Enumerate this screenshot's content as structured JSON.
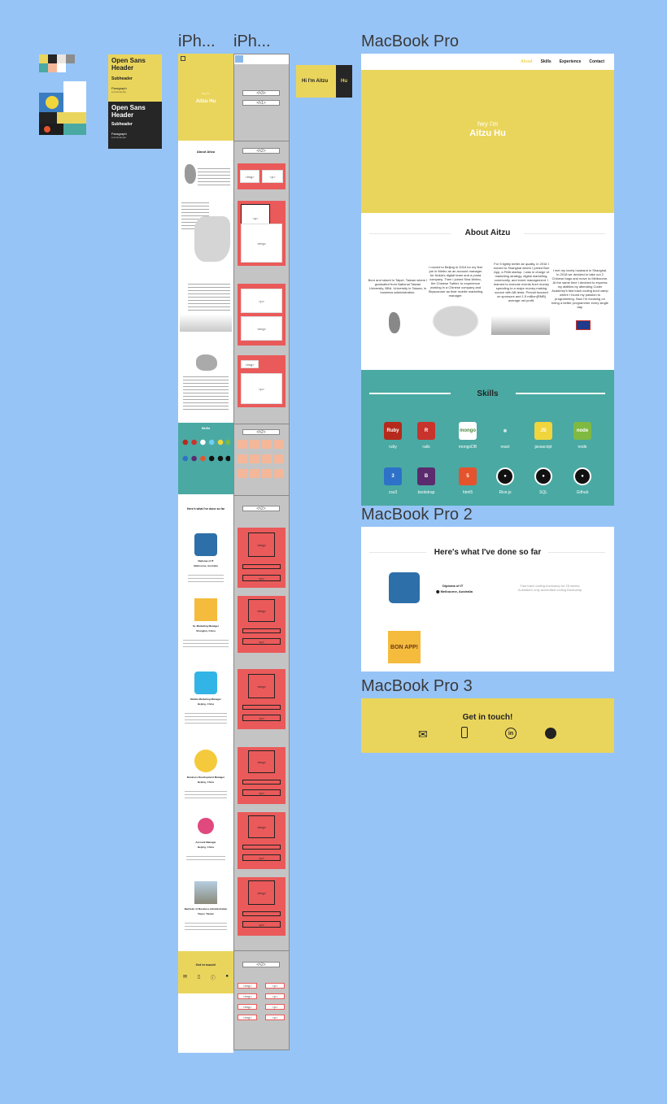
{
  "frames": {
    "iphone1": "iPh...",
    "iphone2": "iPh...",
    "macbook": "MacBook Pro",
    "macbook2": "MacBook Pro 2",
    "macbook3": "MacBook Pro 3"
  },
  "style_guide": {
    "light": {
      "header": "Open Sans Header",
      "subheader": "Subheader",
      "paragraph": "Paragraph",
      "link": "Link Example"
    },
    "dark": {
      "header": "Open Sans Header",
      "subheader": "Subheader",
      "paragraph": "Paragraph",
      "link": "Link Example"
    },
    "colors": [
      "#ead55c",
      "#262626",
      "#eae6df",
      "#8c8c8c",
      "#4aa9a3",
      "#f4b799",
      "#ffffff"
    ]
  },
  "logo": {
    "text": "Hi I'm Aitzu",
    "accent": "Hu"
  },
  "iphone": {
    "hero_hey": "hey i'm",
    "hero_name": "Aitzu Hu",
    "about_title": "About Aitzu",
    "skills_title": "Skills",
    "done_title": "Here's what I've done so far",
    "contact_title": "Get in touch!",
    "jobs": [
      {
        "title": "Diploma of IT",
        "place": "Melbourne, Australia"
      },
      {
        "title": "Sr. Marketing Manager",
        "place": "Shanghai, China"
      },
      {
        "title": "Mobile Marketing Manager",
        "place": "Beijing, China"
      },
      {
        "title": "Business Development Manager",
        "place": "Beijing, China"
      },
      {
        "title": "Account Manager",
        "place": "Beijing, China"
      },
      {
        "title": "Bachelor of Business Administration",
        "place": "Taipei, Taiwan"
      }
    ]
  },
  "wireframe": {
    "h3": "<h3>",
    "h1": "<h1>",
    "h2": "<h2>",
    "img": "<img>",
    "p": "<p>"
  },
  "macbook": {
    "nav": [
      "About",
      "Skills",
      "Experience",
      "Contact"
    ],
    "hero_hey": "hey i'm",
    "hero_name": "Aitzu Hu",
    "about_title": "About Aitzu",
    "about_paras": [
      "Born and raised in Taipei, Taiwan where I graduated from National Taiwan University, BBA. University in Taiwan, in business administration.",
      "I moved to Beijing in 2016 for my first job in Weibo as an account manager for Nokia's digital team and a posta company. Then I joined Sina Weibo, the Chinese Twitter, to experience working in a Chinese company and Skyscanner as their mobile marketing manager.",
      "For 5 lightly better air quality, in 2016 I moved to Shanghai where I joined Bon App, a FMA startup. I was in charge of marketing strategy, digital marketing, community, and event management. I learned to execute events from money spending to a major money-making source with AB tests. Prevail focused on sponsors and 1.5 million(RMB) average net profit.",
      "I met my lovely husband in Shanghai. In 2018 we decided to take out 2 Chinese bags and move to Melbourne. At the same time I decided to express my abilities by attending Coder Academy's fast track coding boot camp where I found my passion to programming. Now I'm focusing on being a better programmer every single day."
    ],
    "skills_title": "Skills",
    "skills": [
      {
        "name": "ruby",
        "icon": "ruby-icon",
        "color": "#b52a1c",
        "glyph": "Ruby"
      },
      {
        "name": "rails",
        "icon": "rails-icon",
        "color": "#c8332c",
        "glyph": "R"
      },
      {
        "name": "mongoDB",
        "icon": "mongodb-icon",
        "color": "#ffffff",
        "glyph": "mongo"
      },
      {
        "name": "react",
        "icon": "react-icon",
        "color": "#4aa9a3",
        "glyph": "⚛"
      },
      {
        "name": "javascript",
        "icon": "javascript-icon",
        "color": "#f0d53c",
        "glyph": "JS"
      },
      {
        "name": "node",
        "icon": "node-icon",
        "color": "#7fb942",
        "glyph": "node"
      },
      {
        "name": "css3",
        "icon": "css3-icon",
        "color": "#2d72c8",
        "glyph": "3"
      },
      {
        "name": "bootstrap",
        "icon": "bootstrap-icon",
        "color": "#5b2b6e",
        "glyph": "B"
      },
      {
        "name": "html5",
        "icon": "html5-icon",
        "color": "#e5532d",
        "glyph": "5"
      },
      {
        "name": "Rive.js",
        "icon": "github-icon",
        "color": "#111111",
        "glyph": "●"
      },
      {
        "name": "SQL",
        "icon": "github-icon",
        "color": "#111111",
        "glyph": "●"
      },
      {
        "name": "Github",
        "icon": "github-icon",
        "color": "#111111",
        "glyph": "●"
      }
    ],
    "done_title": "Here's what I've done so far",
    "done_item": {
      "title": "Diploma of IT",
      "place": "Melbourne, Australia",
      "desc": "Fast track coding bootcamp for 25 weeks Australia's only accredited coding Bootcamp"
    },
    "bon_app": "BON APP!",
    "contact_title": "Get in touch!"
  }
}
